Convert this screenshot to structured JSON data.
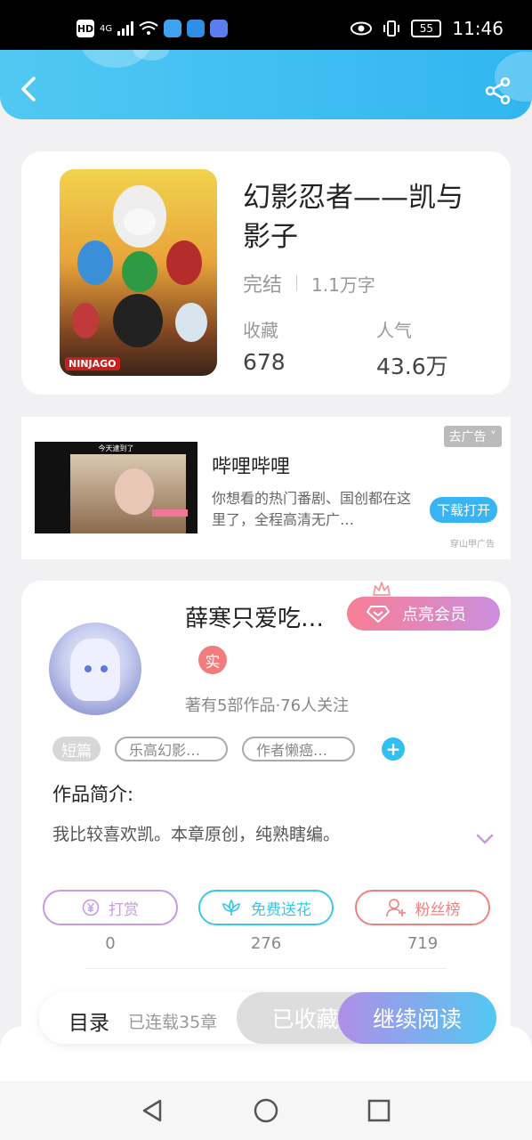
{
  "status_bar": {
    "network": "4G",
    "battery": "55",
    "time": "11:46",
    "hd": "HD"
  },
  "header": {
    "back_icon": "back-arrow-icon",
    "share_icon": "share-icon"
  },
  "book": {
    "title": "幻影忍者——凯与影子",
    "status": "完结",
    "word_count": "1.1万字",
    "favorites_label": "收藏",
    "favorites_value": "678",
    "popularity_label": "人气",
    "popularity_value": "43.6万",
    "cover_logo": "NINJAGO"
  },
  "ad": {
    "badge": "去广告 ˅",
    "title": "哔哩哔哩",
    "description": "你想看的热门番剧、国创都在这里了，全程高清无广…",
    "download_button": "下载打开",
    "source": "穿山甲广告",
    "thumb_caption": "今天逮到了"
  },
  "author": {
    "name": "薛寒只爱吃…",
    "vip_button": "点亮会员",
    "real_badge": "实",
    "meta": "著有5部作品·76人关注",
    "genre_tag": "短篇",
    "tags": [
      "乐高幻影…",
      "作者懒癌…"
    ],
    "add_tag": "+"
  },
  "intro": {
    "label": "作品简介:",
    "text": "我比较喜欢凯。本章原创，纯熟瞎编。"
  },
  "actions": [
    {
      "label": "打赏",
      "count": "0",
      "icon": "yen-coin-icon",
      "color": "#c89ae0"
    },
    {
      "label": "免费送花",
      "count": "276",
      "icon": "flower-icon",
      "color": "#3cc6e8"
    },
    {
      "label": "粉丝榜",
      "count": "719",
      "icon": "fan-user-icon",
      "color": "#f08080"
    }
  ],
  "bottom_bar": {
    "toc_label": "目录",
    "chapter_count": "已连载35章",
    "collected_button": "已收藏",
    "read_button": "继续阅读"
  },
  "colors": {
    "accent_blue": "#38b4f4",
    "vip_pink": "#f87e94",
    "vip_purple": "#cc8fdf"
  }
}
